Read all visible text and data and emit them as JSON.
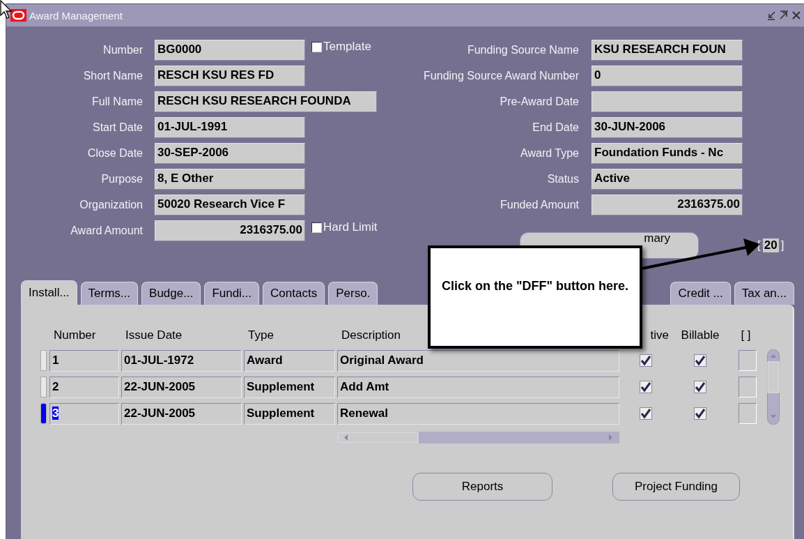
{
  "window": {
    "title": "Award Management"
  },
  "form_left": [
    {
      "label": "Number",
      "value": "BG0000",
      "kind": "text",
      "check": {
        "label": "Template",
        "checked": false
      }
    },
    {
      "label": "Short Name",
      "value": "RESCH  KSU RES FD",
      "kind": "text"
    },
    {
      "label": "Full Name",
      "value": "RESCH KSU RESEARCH FOUNDA",
      "kind": "wide"
    },
    {
      "label": "Start Date",
      "value": "01-JUL-1991",
      "kind": "text"
    },
    {
      "label": "Close Date",
      "value": "30-SEP-2006",
      "kind": "text"
    },
    {
      "label": "Purpose",
      "value": "8, E Other",
      "kind": "text"
    },
    {
      "label": "Organization",
      "value": "50020 Research Vice F",
      "kind": "text"
    },
    {
      "label": "Award Amount",
      "value": "2316375.00",
      "kind": "amount",
      "check": {
        "label": "Hard Limit",
        "checked": false
      }
    }
  ],
  "form_right": [
    {
      "label": "Funding Source Name",
      "value": "KSU RESEARCH FOUN",
      "kind": "text"
    },
    {
      "label": "Funding Source Award Number",
      "value": "0",
      "kind": "text"
    },
    {
      "label": "Pre-Award Date",
      "kind": "text"
    },
    {
      "label": "End Date",
      "value": "30-JUN-2006",
      "kind": "text"
    },
    {
      "label": "Award Type",
      "value": "Foundation Funds - Nc",
      "kind": "text"
    },
    {
      "label": "Status",
      "value": "Active",
      "kind": "text"
    },
    {
      "label": "Funded Amount",
      "value": "2316375.00",
      "kind": "amount"
    }
  ],
  "funding_summary_button": "mary",
  "record_count": {
    "open": "[",
    "value": "20",
    "close": "]"
  },
  "callout": "Click on the \"DFF\" button here.",
  "tabs": [
    {
      "label": "Install...",
      "selected": true
    },
    {
      "label": "Terms...",
      "selected": false
    },
    {
      "label": "Budge...",
      "selected": false
    },
    {
      "label": "Fundi...",
      "selected": false
    },
    {
      "label": "Contacts",
      "selected": false
    },
    {
      "label": "Perso.",
      "selected": false
    },
    {
      "label": "Credit ...",
      "selected": false
    },
    {
      "label": "Tax an...",
      "selected": false
    }
  ],
  "table": {
    "columns": [
      "Number",
      "Issue Date",
      "Type",
      "Description",
      "tive",
      "Billable",
      "[ ]"
    ],
    "rows": [
      {
        "number": "1",
        "issue_date": "01-JUL-1972",
        "type": "Award",
        "description": "Original Award",
        "active": true,
        "billable": true,
        "selected": false
      },
      {
        "number": "2",
        "issue_date": "22-JUN-2005",
        "type": "Supplement",
        "description": "Add Amt",
        "active": true,
        "billable": true,
        "selected": false
      },
      {
        "number": "3",
        "issue_date": "22-JUN-2005",
        "type": "Supplement",
        "description": "Renewal",
        "active": true,
        "billable": true,
        "selected": true
      }
    ]
  },
  "buttons": [
    "Reports",
    "Project Funding"
  ]
}
